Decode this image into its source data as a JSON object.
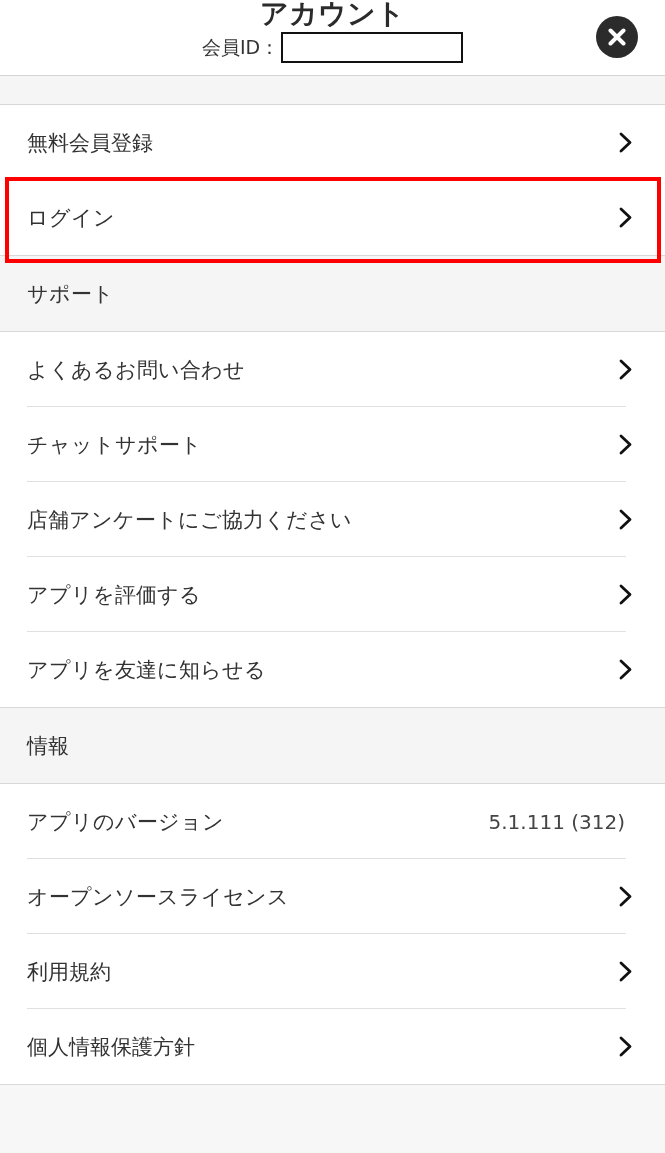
{
  "header": {
    "title": "アカウント",
    "member_id": {
      "label": "会員ID："
    }
  },
  "sections": [
    {
      "items": [
        {
          "label": "無料会員登録",
          "kind": "link",
          "highlighted": false
        },
        {
          "label": "ログイン",
          "kind": "link",
          "highlighted": true
        }
      ]
    },
    {
      "title": "サポート",
      "items": [
        {
          "label": "よくあるお問い合わせ",
          "kind": "link",
          "highlighted": false
        },
        {
          "label": "チャットサポート",
          "kind": "link",
          "highlighted": false
        },
        {
          "label": "店舗アンケートにご協力ください",
          "kind": "link",
          "highlighted": false
        },
        {
          "label": "アプリを評価する",
          "kind": "link",
          "highlighted": false
        },
        {
          "label": "アプリを友達に知らせる",
          "kind": "link",
          "highlighted": false
        }
      ]
    },
    {
      "title": "情報",
      "items": [
        {
          "label": "アプリのバージョン",
          "kind": "value",
          "value": "5.1.111 (312)",
          "highlighted": false
        },
        {
          "label": "オープンソースライセンス",
          "kind": "link",
          "highlighted": false
        },
        {
          "label": "利用規約",
          "kind": "link",
          "highlighted": false
        },
        {
          "label": "個人情報保護方針",
          "kind": "link",
          "highlighted": false
        }
      ]
    }
  ]
}
